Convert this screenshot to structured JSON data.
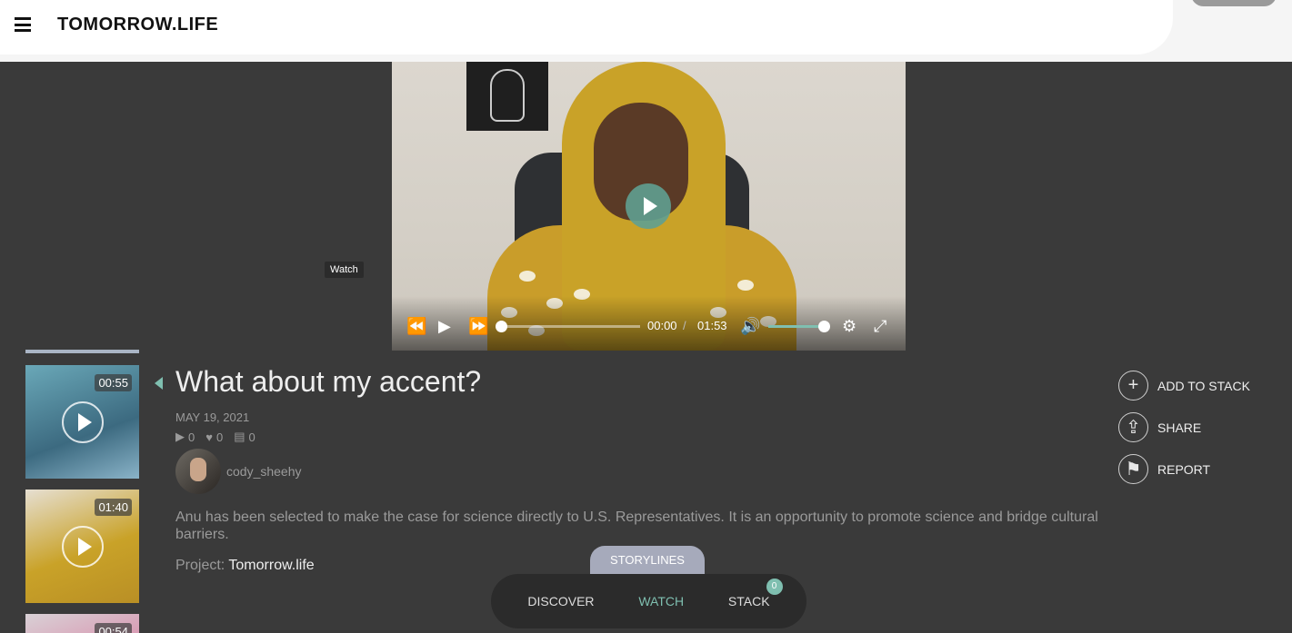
{
  "header": {
    "logo": "TOMORROW.LIFE"
  },
  "player": {
    "current_time": "00:00",
    "separator": "/",
    "duration": "01:53",
    "tooltip": "Watch",
    "progress_fraction": 0.0,
    "volume_fraction": 0.95
  },
  "thumbnails": [
    {
      "duration": "00:55"
    },
    {
      "duration": "01:40"
    },
    {
      "duration": "00:54"
    }
  ],
  "story": {
    "title": "What about my accent?",
    "date": "MAY 19, 2021",
    "plays": "0",
    "likes": "0",
    "comments": "0",
    "username": "cody_sheehy",
    "description": "Anu has been selected to make the case for science directly to U.S. Representatives. It is an opportunity to promote science and bridge cultural barriers.",
    "project_label": "Project:",
    "project_name": "Tomorrow.life"
  },
  "actions": {
    "add_to_stack": "ADD TO STACK",
    "share": "SHARE",
    "report": "REPORT"
  },
  "bottom_nav": {
    "storylines": "STORYLINES",
    "discover": "DISCOVER",
    "watch": "WATCH",
    "stack": "STACK",
    "stack_count": "0"
  },
  "colors": {
    "accent": "#7fbfb0",
    "background": "#3a3a3a"
  }
}
